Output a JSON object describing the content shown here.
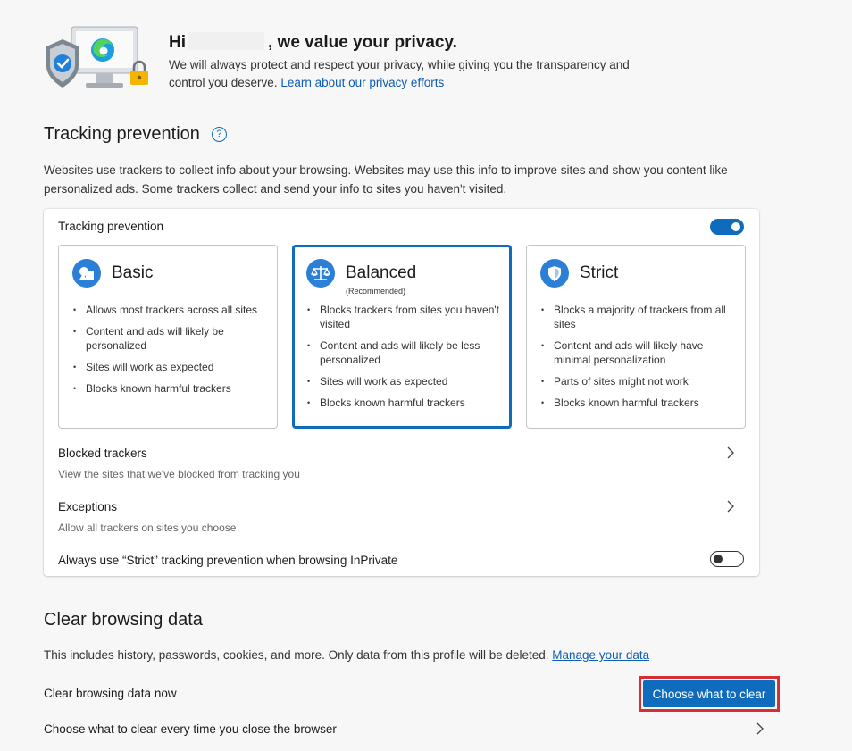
{
  "header": {
    "greeting_prefix": "Hi",
    "greeting_suffix": ", we value your privacy.",
    "description": "We will always protect and respect your privacy, while giving you the transparency and control you deserve.",
    "privacy_link": "Learn about our privacy efforts"
  },
  "tracking": {
    "title": "Tracking prevention",
    "help_glyph": "?",
    "description": "Websites use trackers to collect info about your browsing. Websites may use this info to improve sites and show you content like personalized ads. Some trackers collect and send your info to sites you haven't visited.",
    "toggle_label": "Tracking prevention",
    "toggle_on": true,
    "options": [
      {
        "name": "Basic",
        "icon": "basic-shapes-icon",
        "selected": false,
        "bullets": [
          "Allows most trackers across all sites",
          "Content and ads will likely be personalized",
          "Sites will work as expected",
          "Blocks known harmful trackers"
        ]
      },
      {
        "name": "Balanced",
        "subtitle": "(Recommended)",
        "icon": "scale-icon",
        "selected": true,
        "bullets": [
          "Blocks trackers from sites you haven't visited",
          "Content and ads will likely be less personalized",
          "Sites will work as expected",
          "Blocks known harmful trackers"
        ]
      },
      {
        "name": "Strict",
        "icon": "shield-icon",
        "selected": false,
        "bullets": [
          "Blocks a majority of trackers from all sites",
          "Content and ads will likely have minimal personalization",
          "Parts of sites might not work",
          "Blocks known harmful trackers"
        ]
      }
    ],
    "blocked": {
      "title": "Blocked trackers",
      "subtitle": "View the sites that we've blocked from tracking you"
    },
    "exceptions": {
      "title": "Exceptions",
      "subtitle": "Allow all trackers on sites you choose"
    },
    "inprivate": {
      "label": "Always use “Strict” tracking prevention when browsing InPrivate",
      "toggle_on": false
    }
  },
  "clear": {
    "title": "Clear browsing data",
    "description": "This includes history, passwords, cookies, and more. Only data from this profile will be deleted.",
    "manage_link": "Manage your data",
    "now_label": "Clear browsing data now",
    "button_label": "Choose what to clear",
    "on_close_label": "Choose what to clear every time you close the browser"
  },
  "colors": {
    "accent": "#0f6cbd",
    "highlight_border": "#d62f33"
  }
}
